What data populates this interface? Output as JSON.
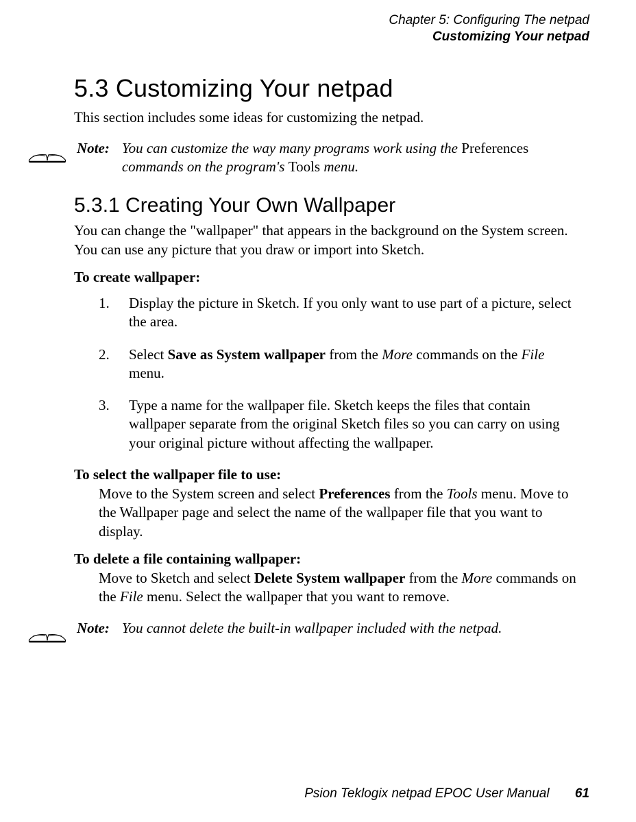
{
  "header": {
    "chapter": "Chapter 5:  Configuring The netpad",
    "section": "Customizing Your netpad"
  },
  "h1": "5.3  Customizing Your netpad",
  "intro": "This section includes some ideas for customizing the netpad.",
  "note1": {
    "label": "Note:",
    "pre": "You can customize the way many programs work using the ",
    "upright1": "Preferences",
    "mid": " commands on the program's ",
    "upright2": "Tools",
    "post": " menu."
  },
  "h2": "5.3.1  Creating Your Own Wallpaper",
  "p2": "You can change the \"wallpaper\" that appears in the background on the System screen. You can use any picture that you draw or import into Sketch.",
  "createHead": "To create wallpaper:",
  "steps": {
    "s1": "Display the picture in Sketch. If you only want to use part of a picture, select the area.",
    "s2_pre": "Select ",
    "s2_bold": "Save as System wallpaper",
    "s2_mid": " from the ",
    "s2_ital1": "More",
    "s2_mid2": " commands on the ",
    "s2_ital2": "File",
    "s2_post": " menu.",
    "s3": "Type a name for the wallpaper file. Sketch keeps the files that contain wallpaper separate from the original Sketch files so you can carry on using your original picture without affecting the wallpaper."
  },
  "selectHead": "To select the wallpaper file to use:",
  "select_pre": "Move to the System screen and select ",
  "select_bold": "Preferences",
  "select_mid": " from the ",
  "select_ital": "Tools",
  "select_post": " menu. Move to the Wallpaper page and select the name of the wallpaper file that you want to display.",
  "deleteHead": "To delete a file containing wallpaper:",
  "delete_pre": "Move to Sketch and select ",
  "delete_bold": "Delete System wallpaper",
  "delete_mid": " from the ",
  "delete_ital1": "More",
  "delete_mid2": " commands on the ",
  "delete_ital2": "File",
  "delete_post": " menu. Select the wallpaper that you want to remove.",
  "note2": {
    "label": "Note:",
    "text": "You cannot delete the built-in wallpaper included with the netpad."
  },
  "footer": {
    "title": "Psion Teklogix netpad EPOC User Manual",
    "page": "61"
  }
}
